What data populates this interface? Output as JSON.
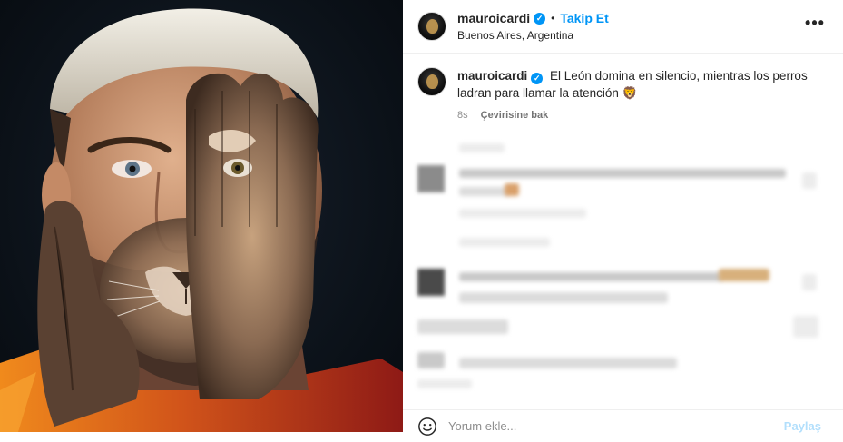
{
  "header": {
    "username": "mauroicardi",
    "verified_mark": "✓",
    "separator": "•",
    "follow_label": "Takip Et",
    "location": "Buenos Aires, Argentina",
    "more_label": "•••"
  },
  "caption": {
    "username": "mauroicardi",
    "text": "El León domina en silencio, mientras los perros ladran para llamar la atención 🦁",
    "time": "8s",
    "translate_label": "Çevirisine bak"
  },
  "comment_box": {
    "placeholder": "Yorum ekle...",
    "post_label": "Paylaş"
  },
  "icons": {
    "verified": "verified-badge-icon",
    "more": "more-options-icon",
    "emoji": "emoji-smiley-icon"
  },
  "colors": {
    "accent_blue": "#0095f6",
    "post_button_disabled": "#b2dffc",
    "text_primary": "#262626",
    "text_secondary": "#8e8e8e"
  }
}
